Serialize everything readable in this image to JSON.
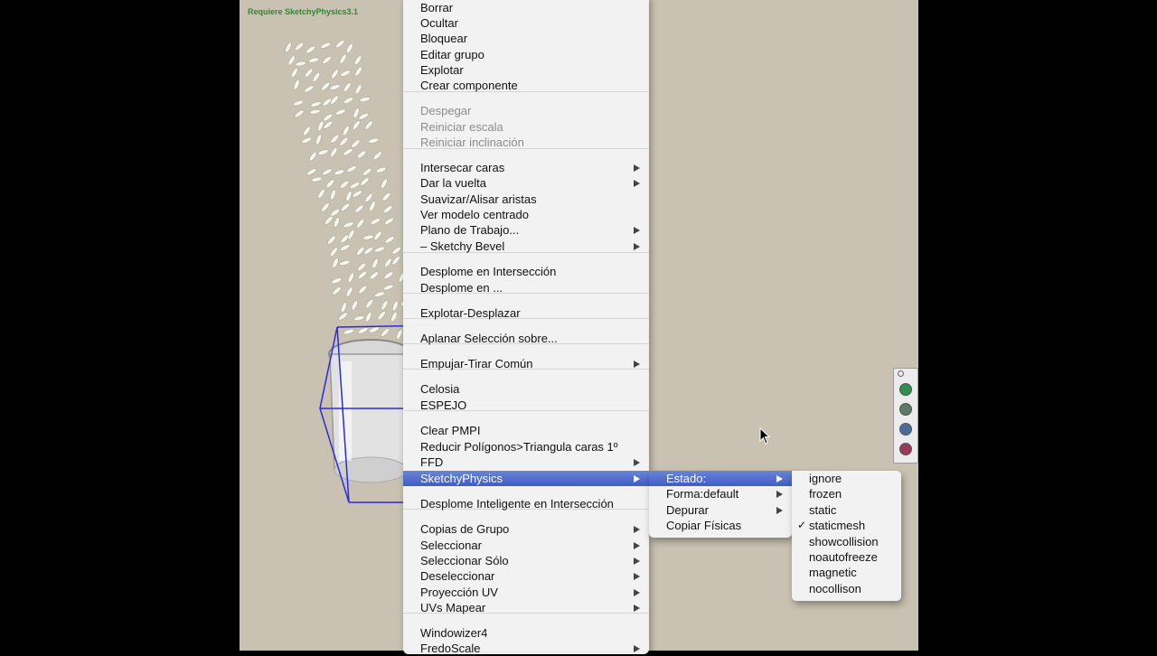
{
  "status_text": "Requiere SketchyPhysics3.1",
  "context_menu": {
    "items": [
      {
        "label": "Borrar"
      },
      {
        "label": "Ocultar"
      },
      {
        "label": "Bloquear"
      },
      {
        "label": "Editar grupo"
      },
      {
        "label": "Explotar"
      },
      {
        "label": "Crear componente"
      },
      {
        "label": "Despegar",
        "disabled": true
      },
      {
        "label": "Reiniciar escala",
        "disabled": true
      },
      {
        "label": "Reiniciar inclinación",
        "disabled": true
      },
      {
        "label": "Intersecar caras",
        "submenu": true
      },
      {
        "label": "Dar la vuelta",
        "submenu": true
      },
      {
        "label": "Suavizar/Alisar aristas"
      },
      {
        "label": "Ver modelo centrado"
      },
      {
        "label": "Plano de Trabajo...",
        "submenu": true
      },
      {
        "label": "– Sketchy Bevel",
        "submenu": true
      },
      {
        "label": "Desplome en Intersección"
      },
      {
        "label": "Desplome en ..."
      },
      {
        "label": "Explotar-Desplazar"
      },
      {
        "label": "Aplanar Selección sobre..."
      },
      {
        "label": "Empujar-Tirar Común",
        "submenu": true
      },
      {
        "label": "Celosia"
      },
      {
        "label": "ESPEJO"
      },
      {
        "label": "Clear PMPI"
      },
      {
        "label": "Reducir Polígonos>Triangula caras 1º"
      },
      {
        "label": "FFD",
        "submenu": true
      },
      {
        "label": "SketchyPhysics",
        "submenu": true,
        "highlighted": true
      },
      {
        "label": "Desplome Inteligente en Intersección"
      },
      {
        "label": "Copias de Grupo",
        "submenu": true
      },
      {
        "label": "Seleccionar",
        "submenu": true
      },
      {
        "label": "Seleccionar Sólo",
        "submenu": true
      },
      {
        "label": "Deseleccionar",
        "submenu": true
      },
      {
        "label": "Proyección UV",
        "submenu": true
      },
      {
        "label": "UVs Mapear",
        "submenu": true
      },
      {
        "label": "Windowizer4"
      },
      {
        "label": "FredoScale",
        "submenu": true
      }
    ]
  },
  "sketchy_submenu": {
    "items": [
      {
        "label": "Estado:",
        "submenu": true,
        "highlighted": true
      },
      {
        "label": "Forma:default",
        "submenu": true
      },
      {
        "label": "Depurar",
        "submenu": true
      },
      {
        "label": "Copiar Físicas"
      }
    ]
  },
  "estado_submenu": {
    "items": [
      {
        "label": "ignore"
      },
      {
        "label": "frozen"
      },
      {
        "label": "static"
      },
      {
        "label": "staticmesh",
        "checked": true
      },
      {
        "label": "showcollision"
      },
      {
        "label": "noautofreeze"
      },
      {
        "label": "magnetic"
      },
      {
        "label": "nocollison"
      }
    ]
  },
  "toolbar": {
    "buttons": [
      {
        "icon": "play-icon",
        "color": "#2f8f4f"
      },
      {
        "icon": "rewind-icon",
        "color": "#5a7a6a"
      },
      {
        "icon": "pause-icon",
        "color": "#4a6a9a"
      },
      {
        "icon": "joystick-icon",
        "color": "#9a3a5a"
      }
    ]
  },
  "colors": {
    "viewport": "#c9c2b2",
    "highlight": "#4a66cc",
    "selection_box": "#2a2ae0",
    "status_text": "#2c8a2c"
  }
}
